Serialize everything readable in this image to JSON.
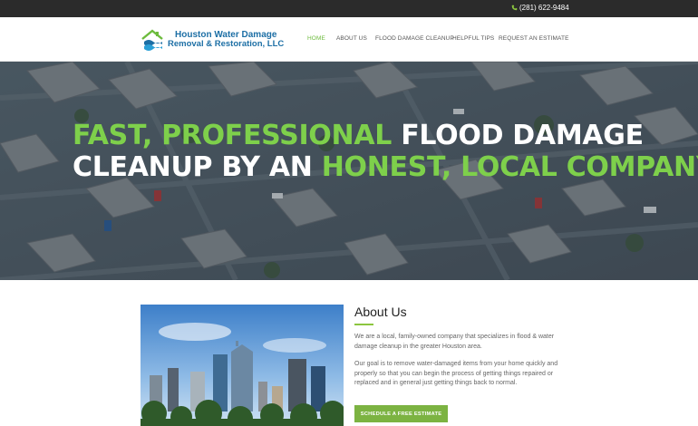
{
  "topbar": {
    "phone": "(281) 622-9484"
  },
  "logo": {
    "line1": "Houston Water Damage",
    "line2": "Removal & Restoration, LLC"
  },
  "nav": {
    "items": [
      {
        "label": "HOME",
        "active": true
      },
      {
        "label": "ABOUT US",
        "active": false
      },
      {
        "label": "FLOOD DAMAGE CLEANUP",
        "active": false
      },
      {
        "label": "HELPFUL TIPS",
        "active": false
      },
      {
        "label": "REQUEST AN ESTIMATE",
        "active": false
      }
    ]
  },
  "hero": {
    "line1_green": "FAST, PROFESSIONAL",
    "line1_white": "FLOOD DAMAGE",
    "line2_white": "CLEANUP BY AN",
    "line2_green": "HONEST, LOCAL COMPANY."
  },
  "about": {
    "title": "About Us",
    "p1": "We are a local, family-owned company that specializes in flood & water damage cleanup in the greater Houston area.",
    "p2": "Our goal is to remove water-damaged items from your home quickly and properly so that you can begin the process of getting things repaired or replaced and in general just getting things back to normal.",
    "cta": "SCHEDULE A FREE ESTIMATE"
  },
  "colors": {
    "accent": "#7cb342",
    "hero_green": "#7ed04b",
    "topbar": "#2b2b2b",
    "logo_blue": "#1d6fa5"
  }
}
